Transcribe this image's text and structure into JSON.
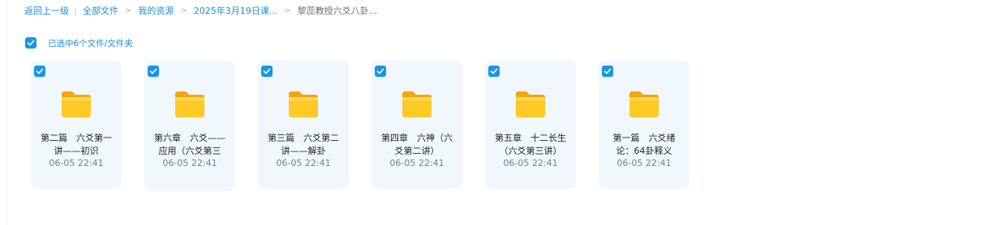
{
  "breadcrumb": {
    "back": "返回上一级",
    "items": [
      "全部文件",
      "我的资源",
      "2025年3月19日课..."
    ],
    "current": "黎蕊教授六爻八卦..."
  },
  "selection": {
    "text": "已选中6个文件/文件夹",
    "all_checked": true
  },
  "colors": {
    "accent": "#1a96e8",
    "link": "#1a8fd8",
    "card_bg": "#f1f8fd",
    "folder": "#ffc21a"
  },
  "files": [
    {
      "name": "第二篇　六爻第一讲——初识",
      "date": "06-05 22:41",
      "checked": true,
      "icon": "folder-icon"
    },
    {
      "name": "第六章　六爻——应用（六爻第三",
      "date": "06-05 22:41",
      "checked": true,
      "icon": "folder-icon"
    },
    {
      "name": "第三篇　六爻第二讲——解卦",
      "date": "06-05 22:41",
      "checked": true,
      "icon": "folder-icon"
    },
    {
      "name": "第四章　六神（六爻第二讲）",
      "date": "06-05 22:41",
      "checked": true,
      "icon": "folder-icon"
    },
    {
      "name": "第五章　十二长生（六爻第三讲）",
      "date": "06-05 22:41",
      "checked": true,
      "icon": "folder-icon"
    },
    {
      "name": "第一篇　六爻绪论：64卦释义",
      "date": "06-05 22:41",
      "checked": true,
      "icon": "folder-icon"
    }
  ]
}
